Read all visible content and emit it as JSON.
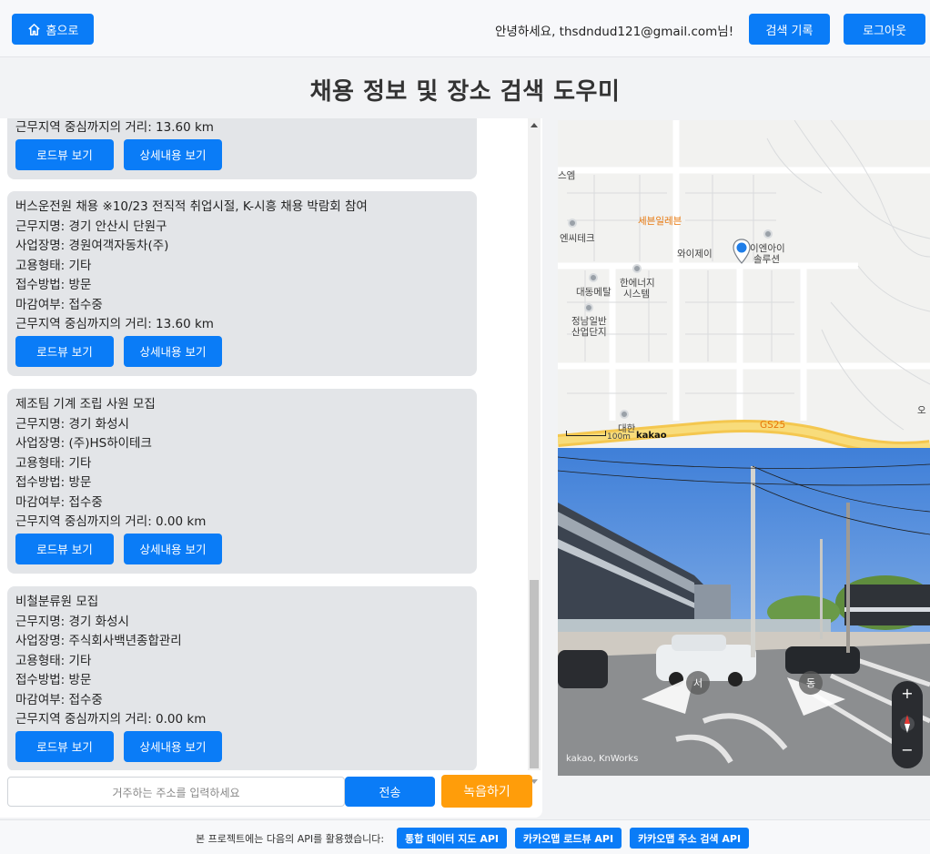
{
  "header": {
    "home_label": "홈으로",
    "greeting": "안녕하세요, thsdndud121@gmail.com님!",
    "history_label": "검색 기록",
    "logout_label": "로그아웃"
  },
  "page_title": "채용 정보 및 장소 검색 도우미",
  "jobs": [
    {
      "distance": "근무지역 중심까지의 거리: 13.60 km",
      "roadview_label": "로드뷰 보기",
      "detail_label": "상세내용 보기"
    },
    {
      "title": "버스운전원 채용 ※10/23 전직적 취업시절, K-시흥 채용 박람회 참여",
      "location": "근무지명: 경기 안산시 단원구",
      "company": "사업장명: 경원여객자동차(주)",
      "employment": "고용형태: 기타",
      "method": "접수방법: 방문",
      "status": "마감여부: 접수중",
      "distance": "근무지역 중심까지의 거리: 13.60 km",
      "roadview_label": "로드뷰 보기",
      "detail_label": "상세내용 보기"
    },
    {
      "title": "제조팀 기계 조립 사원 모집",
      "location": "근무지명: 경기 화성시",
      "company": "사업장명: (주)HS하이테크",
      "employment": "고용형태: 기타",
      "method": "접수방법: 방문",
      "status": "마감여부: 접수중",
      "distance": "근무지역 중심까지의 거리: 0.00 km",
      "roadview_label": "로드뷰 보기",
      "detail_label": "상세내용 보기"
    },
    {
      "title": "비철분류원 모집",
      "location": "근무지명: 경기 화성시",
      "company": "사업장명: 주식회사백년종합관리",
      "employment": "고용형태: 기타",
      "method": "접수방법: 방문",
      "status": "마감여부: 접수중",
      "distance": "근무지역 중심까지의 거리: 0.00 km",
      "roadview_label": "로드뷰 보기",
      "detail_label": "상세내용 보기"
    }
  ],
  "input": {
    "placeholder": "거주하는 주소를 입력하세요",
    "send_label": "전송",
    "record_label": "녹음하기"
  },
  "map": {
    "labels": [
      "스엠",
      "세븐일레븐",
      "엔씨테크",
      "와이제이",
      "이엔아이",
      "솔루션",
      "대동메탈",
      "한에너지",
      "시스템",
      "정남일반",
      "산업단지",
      "대한",
      "GS25",
      "오"
    ],
    "scale": "100m",
    "brand": "kakao"
  },
  "roadview": {
    "west": "서",
    "east": "동",
    "brand": "kakao, KnWorks",
    "zoom_in": "+",
    "zoom_out": "−"
  },
  "footer": {
    "text": "본 프로젝트에는 다음의 API를 활용했습니다:",
    "apis": [
      "통합 데이터 지도 API",
      "카카오맵 로드뷰 API",
      "카카오맵 주소 검색 API"
    ]
  },
  "colors": {
    "primary": "#0a7cf7",
    "record": "#ff9d0a",
    "card": "#e3e5e8"
  }
}
